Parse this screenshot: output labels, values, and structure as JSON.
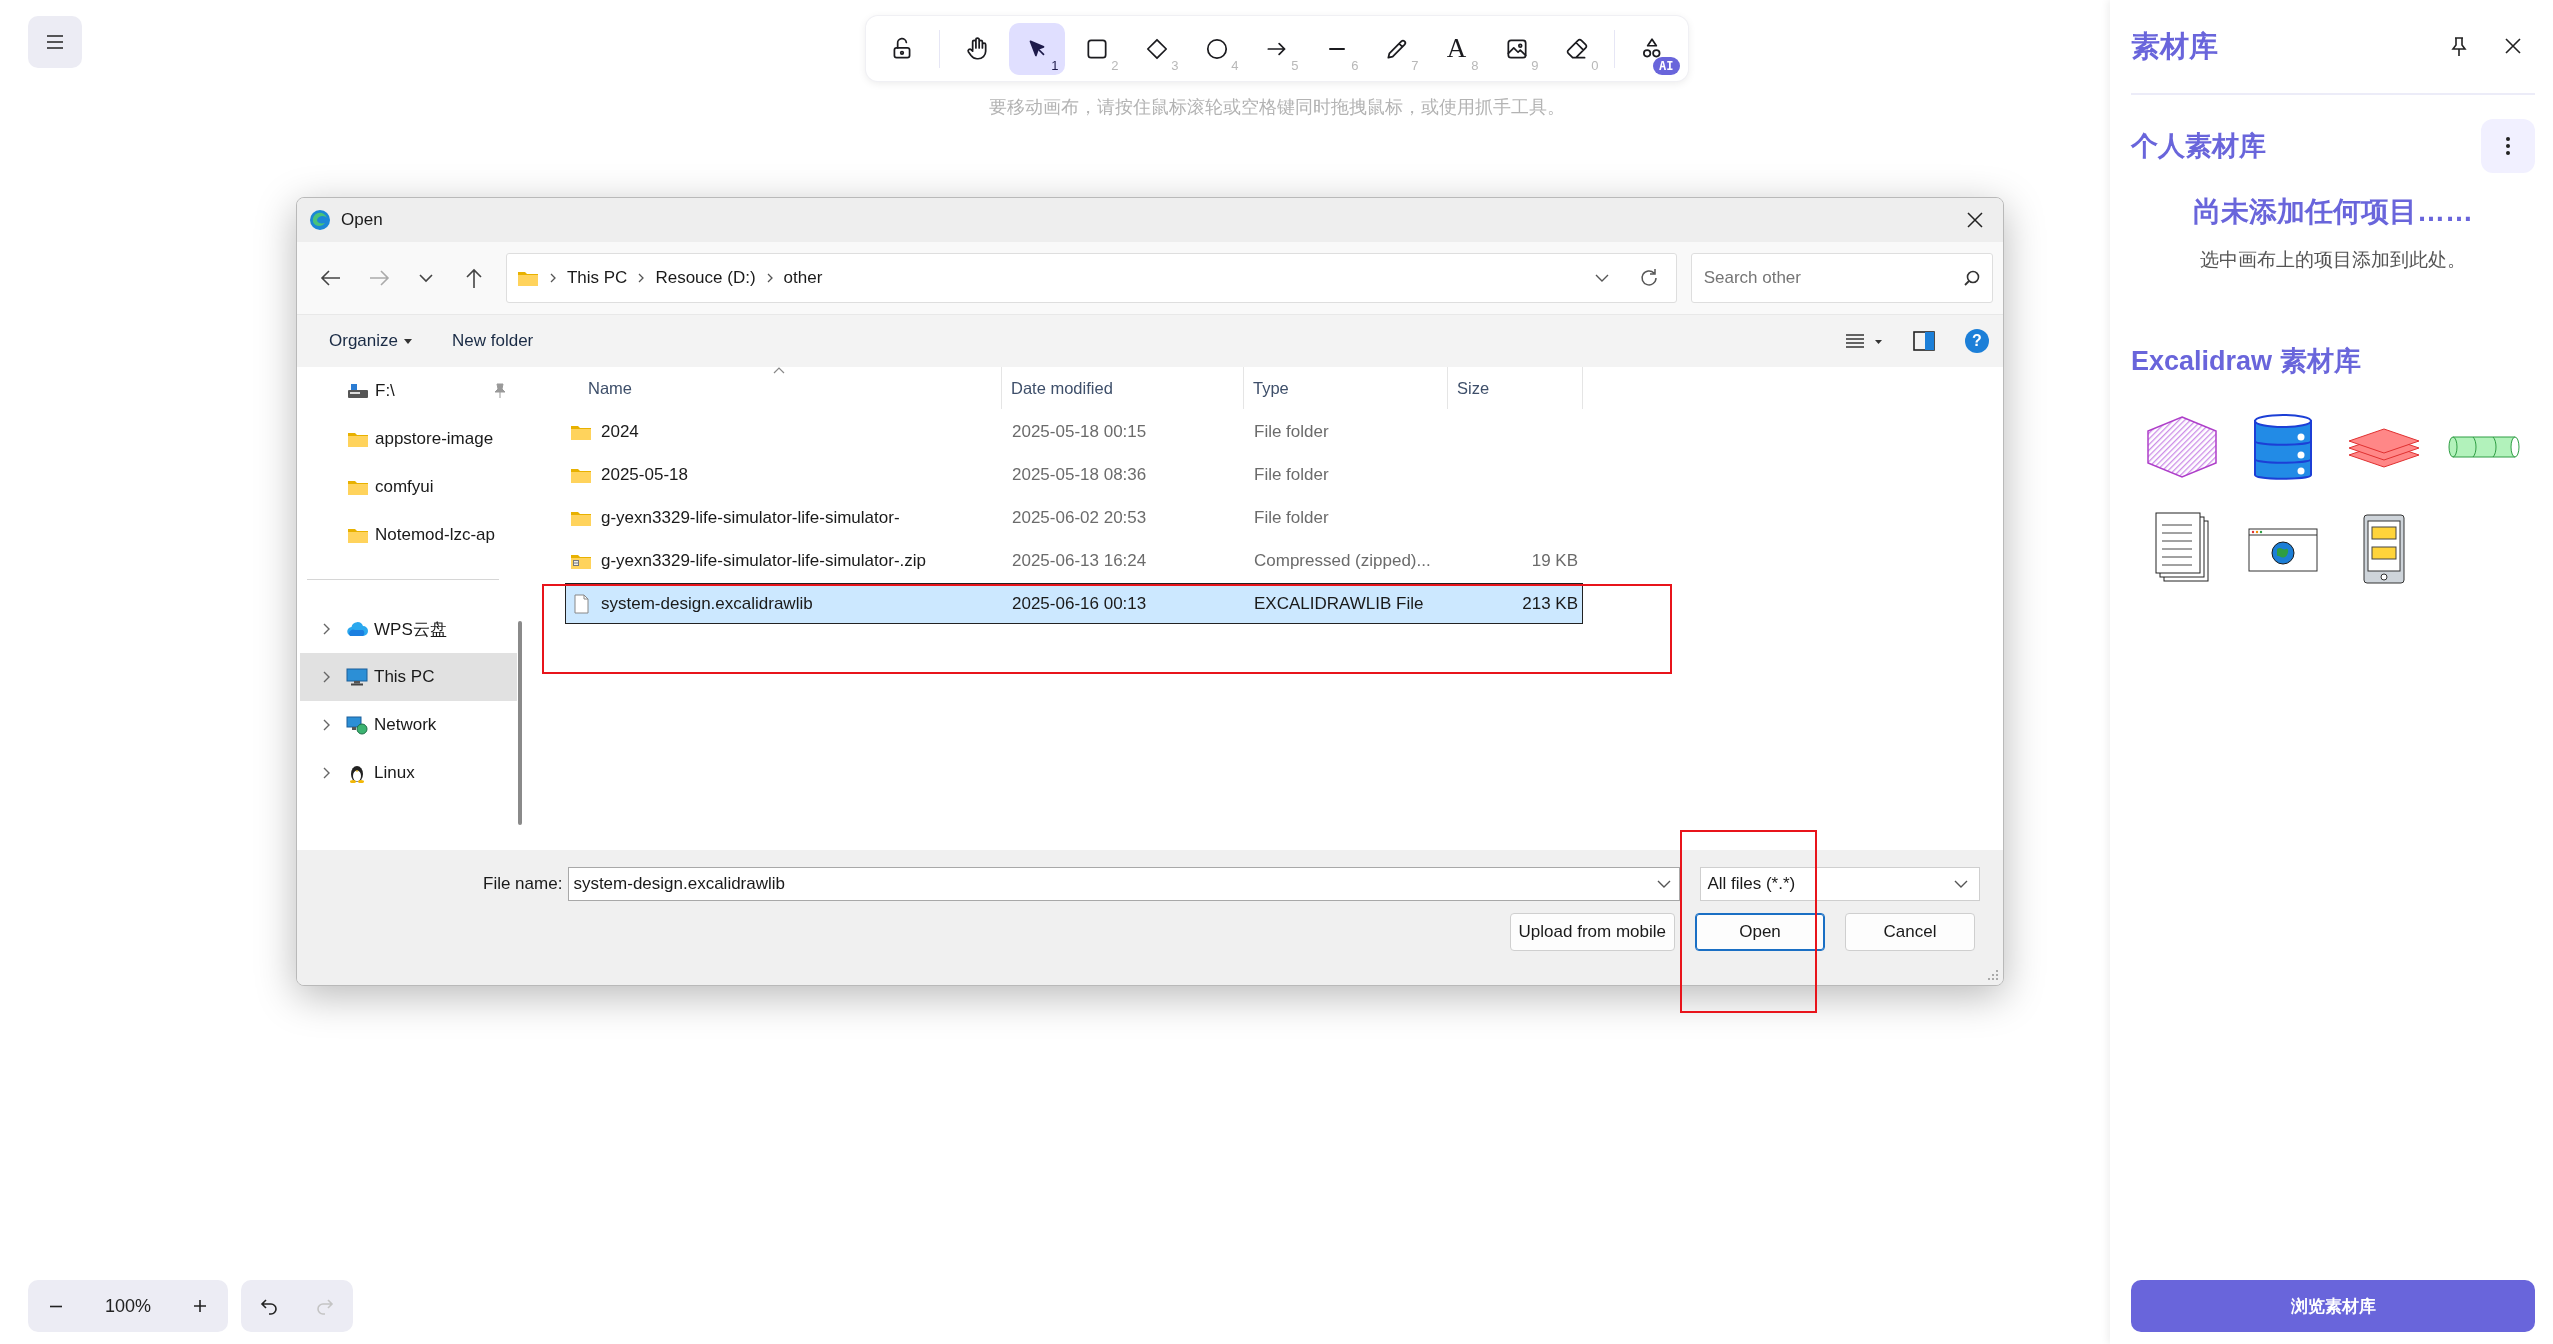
{
  "toolbar": {
    "groups": [
      {
        "tools": [
          {
            "kind": "lock",
            "selected": false
          }
        ]
      },
      {
        "tools": [
          {
            "kind": "hand",
            "selected": false
          },
          {
            "kind": "pointer",
            "key": "1",
            "selected": true
          },
          {
            "kind": "rectangle",
            "key": "2",
            "selected": false
          },
          {
            "kind": "diamond",
            "key": "3",
            "selected": false
          },
          {
            "kind": "ellipse",
            "key": "4",
            "selected": false
          },
          {
            "kind": "arrow",
            "key": "5",
            "selected": false
          },
          {
            "kind": "line",
            "key": "6",
            "selected": false
          },
          {
            "kind": "pencil",
            "key": "7",
            "selected": false
          },
          {
            "kind": "text",
            "glyph": "A",
            "key": "8",
            "selected": false
          },
          {
            "kind": "image",
            "key": "9",
            "selected": false
          },
          {
            "kind": "eraser",
            "key": "0",
            "selected": false
          }
        ]
      },
      {
        "tools": [
          {
            "kind": "shapes",
            "badge": "AI",
            "selected": false
          }
        ]
      }
    ]
  },
  "canvas_hint": "要移动画布，请按住鼠标滚轮或空格键同时拖拽鼠标，或使用抓手工具。",
  "dialog": {
    "title": "Open",
    "breadcrumb": [
      "This PC",
      "Resouce (D:)",
      "other"
    ],
    "search": {
      "placeholder": "Search other"
    },
    "commands": [
      {
        "label": "Organize",
        "menu": true
      },
      {
        "label": "New folder",
        "menu": false
      }
    ],
    "help": "?",
    "quick_access": [
      {
        "label": "F:\\",
        "kind": "drive",
        "pinned": true
      },
      {
        "label": "appstore-image",
        "kind": "folder",
        "pinned": false
      },
      {
        "label": "comfyui",
        "kind": "folder",
        "pinned": false
      },
      {
        "label": "Notemod-lzc-ap",
        "kind": "folder",
        "pinned": false
      }
    ],
    "locations": [
      {
        "label": "WPS云盘",
        "kind": "cloud",
        "selected": false
      },
      {
        "label": "This PC",
        "kind": "monitor",
        "selected": true
      },
      {
        "label": "Network",
        "kind": "network",
        "selected": false
      },
      {
        "label": "Linux",
        "kind": "penguin",
        "selected": false
      }
    ],
    "columns": [
      "Name",
      "Date modified",
      "Type",
      "Size"
    ],
    "files": [
      {
        "name": "2024",
        "date": "2025-05-18 00:15",
        "type": "File folder",
        "kind": "folder",
        "selected": false
      },
      {
        "name": "2025-05-18",
        "date": "2025-05-18 08:36",
        "type": "File folder",
        "kind": "folder",
        "selected": false
      },
      {
        "name": "g-yexn3329-life-simulator-life-simulator-",
        "date": "2025-06-02 20:53",
        "type": "File folder",
        "kind": "folder",
        "selected": false
      },
      {
        "name": "g-yexn3329-life-simulator-life-simulator-.zip",
        "date": "2025-06-13 16:24",
        "type": "Compressed (zipped)...",
        "size": "19 KB",
        "kind": "zip",
        "selected": false
      },
      {
        "name": "system-design.excalidrawlib",
        "date": "2025-06-16 00:13",
        "type": "EXCALIDRAWLIB File",
        "size": "213 KB",
        "kind": "file",
        "selected": true
      }
    ],
    "file_name": {
      "label": "File name:",
      "value": "system-design.excalidrawlib"
    },
    "filter": {
      "value": "All files (*.*)"
    },
    "buttons": [
      {
        "label": "Upload from mobile",
        "default": false
      },
      {
        "label": "Open",
        "default": true
      },
      {
        "label": "Cancel",
        "default": false
      }
    ]
  },
  "annotations": [
    {
      "kind": "red-box"
    },
    {
      "kind": "red-box"
    }
  ],
  "sidebar": {
    "title": "素材库",
    "personal": {
      "title": "个人素材库",
      "empty_title": "尚未添加任何项目……",
      "empty_hint": "选中画布上的项目添加到此处。"
    },
    "library": {
      "title": "Excalidraw 素材库",
      "items": [
        {
          "kind": "hexagon"
        },
        {
          "kind": "database"
        },
        {
          "kind": "layers"
        },
        {
          "kind": "cylinder"
        },
        {
          "kind": "documents"
        },
        {
          "kind": "browser"
        },
        {
          "kind": "tablet"
        }
      ]
    },
    "browse_button": "浏览素材库"
  },
  "footer": {
    "zoom": "100%",
    "undo_disabled": false,
    "redo_disabled": true
  }
}
